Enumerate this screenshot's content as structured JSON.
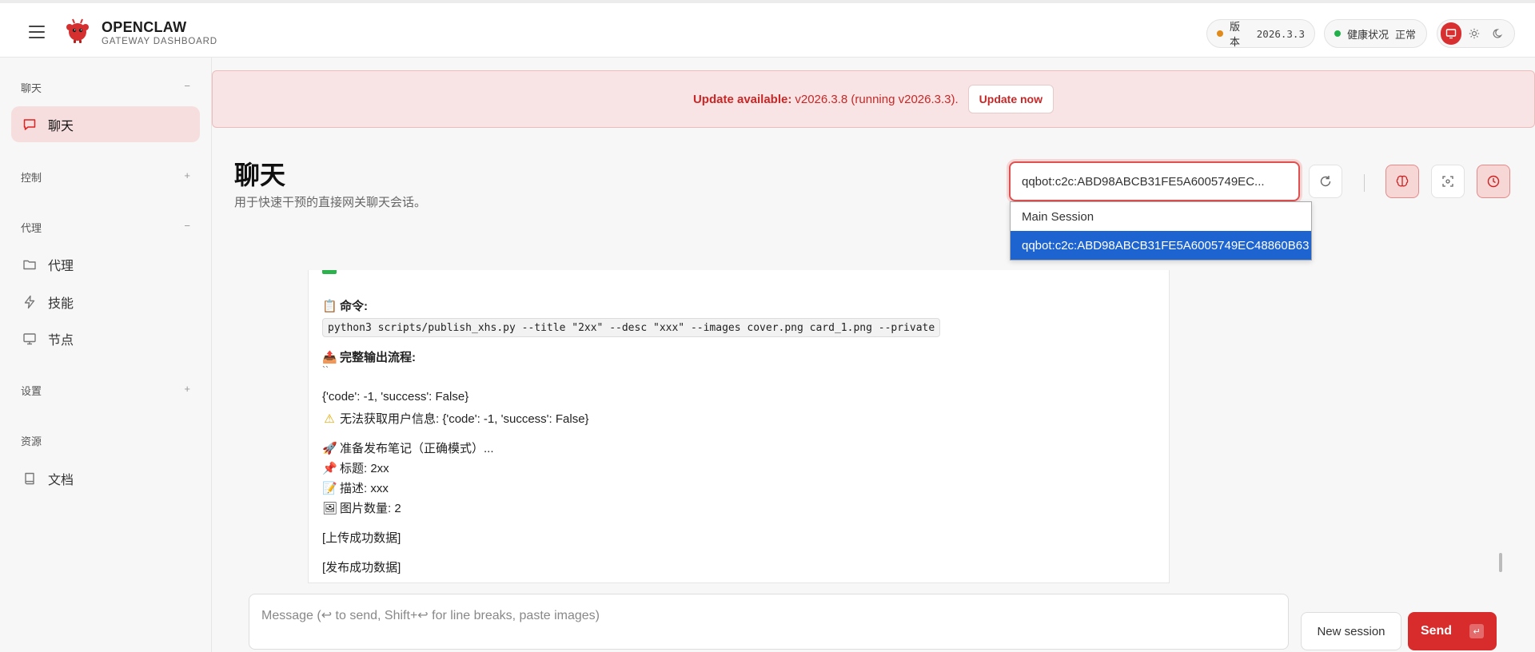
{
  "colors": {
    "accent": "#d82b2b",
    "version_dot": "#e08a1a",
    "health_dot": "#22b04b",
    "selected_option": "#1d64d0"
  },
  "brand": {
    "title": "OPENCLAW",
    "subtitle": "GATEWAY DASHBOARD"
  },
  "status": {
    "version_label": "版本",
    "version_value": "2026.3.3",
    "health_label": "健康状况",
    "health_value": "正常"
  },
  "sidebar": {
    "sections": [
      {
        "title": "聊天",
        "toggle": "−"
      },
      {
        "title": "控制",
        "toggle": "+"
      },
      {
        "title": "代理",
        "toggle": "−"
      },
      {
        "title": "设置",
        "toggle": "+"
      },
      {
        "title": "资源",
        "toggle": ""
      }
    ],
    "items": [
      {
        "label": "聊天",
        "icon": "chat-icon"
      },
      {
        "label": "代理",
        "icon": "folder-icon"
      },
      {
        "label": "技能",
        "icon": "bolt-icon"
      },
      {
        "label": "节点",
        "icon": "monitor-icon"
      },
      {
        "label": "文档",
        "icon": "book-icon"
      }
    ]
  },
  "banner": {
    "prefix": "Update available:",
    "text": "v2026.3.8 (running v2026.3.3).",
    "button": "Update now"
  },
  "page": {
    "title": "聊天",
    "subtitle": "用于快速干预的直接网关聊天会话。"
  },
  "session": {
    "current": "qqbot:c2c:ABD98ABCB31FE5A6005749EC...",
    "options": [
      "Main Session",
      "qqbot:c2c:ABD98ABCB31FE5A6005749EC48860B63"
    ]
  },
  "message": {
    "cmd_label": "命令:",
    "cmd_code": "python3 scripts/publish_xhs.py --title \"2xx\" --desc \"xxx\" --images cover.png card_1.png --private",
    "flow_label": "完整输出流程:",
    "backticks": "``",
    "line1": "{'code': -1, 'success': False}",
    "line2": "无法获取用户信息: {'code': -1, 'success': False}",
    "line3": "准备发布笔记（正确模式）...",
    "line4": "标题: 2xx",
    "line5": "描述: xxx",
    "line6": "图片数量: 2",
    "line7": "[上传成功数据]",
    "line8": "[发布成功数据]"
  },
  "composer": {
    "placeholder": "Message (↩ to send, Shift+↩ for line breaks, paste images)",
    "new_session": "New session",
    "send": "Send",
    "send_key": "↵"
  }
}
